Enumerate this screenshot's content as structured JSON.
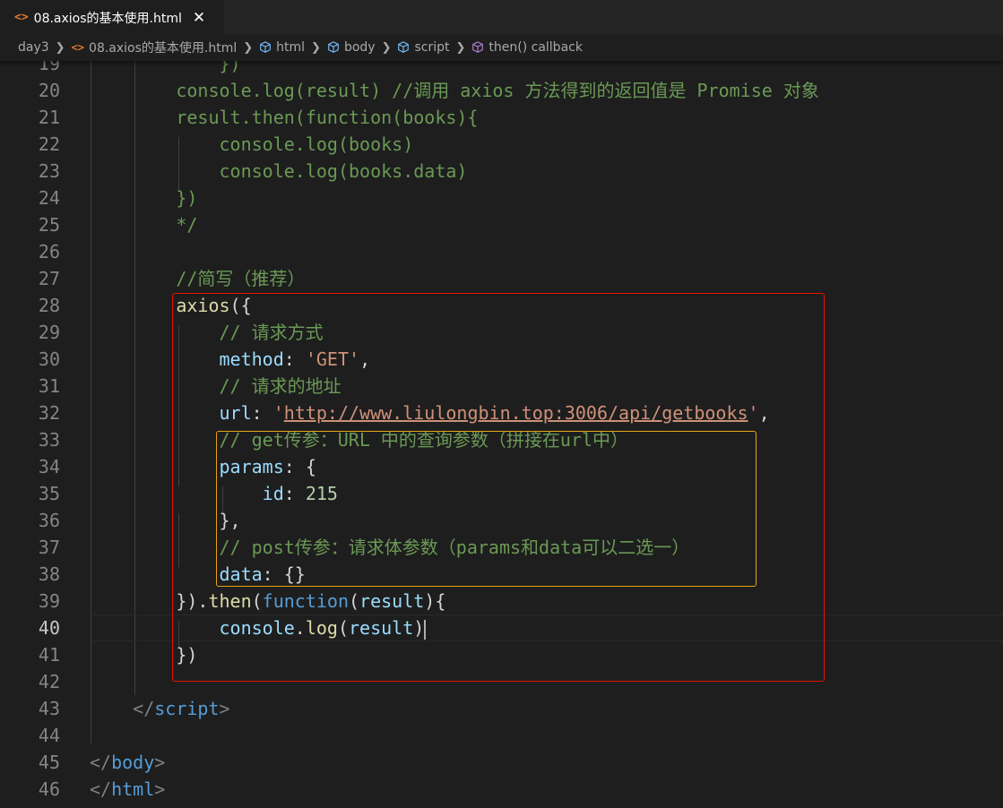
{
  "tab": {
    "title": "08.axios的基本使用.html",
    "close": "✕"
  },
  "breadcrumb": {
    "items": [
      {
        "label": "day3"
      },
      {
        "label": "08.axios的基本使用.html"
      },
      {
        "label": "html"
      },
      {
        "label": "body"
      },
      {
        "label": "script"
      },
      {
        "label": "then() callback"
      }
    ]
  },
  "editor": {
    "active_line": "40",
    "lines": [
      {
        "n": "19",
        "t": [
          [
            "c-comment",
            "            })"
          ]
        ]
      },
      {
        "n": "20",
        "t": [
          [
            "c-comment",
            "        console.log(result) //调用 axios 方法得到的返回值是 Promise 对象"
          ]
        ]
      },
      {
        "n": "21",
        "t": [
          [
            "c-comment",
            "        result.then(function(books){"
          ]
        ]
      },
      {
        "n": "22",
        "t": [
          [
            "c-comment",
            "            console.log(books)"
          ]
        ]
      },
      {
        "n": "23",
        "t": [
          [
            "c-comment",
            "            console.log(books.data)"
          ]
        ]
      },
      {
        "n": "24",
        "t": [
          [
            "c-comment",
            "        })"
          ]
        ]
      },
      {
        "n": "25",
        "t": [
          [
            "c-comment",
            "        */"
          ]
        ]
      },
      {
        "n": "26",
        "t": []
      },
      {
        "n": "27",
        "t": [
          [
            "c-comment",
            "        //简写（推荐）"
          ]
        ]
      },
      {
        "n": "28",
        "t": [
          [
            "c-plain",
            "        "
          ],
          [
            "c-fn",
            "axios"
          ],
          [
            "c-plain",
            "({"
          ]
        ]
      },
      {
        "n": "29",
        "t": [
          [
            "c-plain",
            "            "
          ],
          [
            "c-comment",
            "// 请求方式"
          ]
        ]
      },
      {
        "n": "30",
        "t": [
          [
            "c-plain",
            "            "
          ],
          [
            "c-var",
            "method"
          ],
          [
            "c-plain",
            ": "
          ],
          [
            "c-str",
            "'GET'"
          ],
          [
            "c-plain",
            ","
          ]
        ]
      },
      {
        "n": "31",
        "t": [
          [
            "c-plain",
            "            "
          ],
          [
            "c-comment",
            "// 请求的地址"
          ]
        ]
      },
      {
        "n": "32",
        "t": [
          [
            "c-plain",
            "            "
          ],
          [
            "c-var",
            "url"
          ],
          [
            "c-plain",
            ": "
          ],
          [
            "c-str",
            "'"
          ],
          [
            "c-url",
            "http://www.liulongbin.top:3006/api/getbooks"
          ],
          [
            "c-str",
            "'"
          ],
          [
            "c-plain",
            ","
          ]
        ]
      },
      {
        "n": "33",
        "t": [
          [
            "c-plain",
            "            "
          ],
          [
            "c-comment",
            "// get传参：URL 中的查询参数（拼接在url中）"
          ]
        ]
      },
      {
        "n": "34",
        "t": [
          [
            "c-plain",
            "            "
          ],
          [
            "c-var",
            "params"
          ],
          [
            "c-plain",
            ": {"
          ]
        ]
      },
      {
        "n": "35",
        "t": [
          [
            "c-plain",
            "                "
          ],
          [
            "c-var",
            "id"
          ],
          [
            "c-plain",
            ": "
          ],
          [
            "c-num",
            "215"
          ]
        ]
      },
      {
        "n": "36",
        "t": [
          [
            "c-plain",
            "            },"
          ]
        ]
      },
      {
        "n": "37",
        "t": [
          [
            "c-plain",
            "            "
          ],
          [
            "c-comment",
            "// post传参：请求体参数（params和data可以二选一）"
          ]
        ]
      },
      {
        "n": "38",
        "t": [
          [
            "c-plain",
            "            "
          ],
          [
            "c-var",
            "data"
          ],
          [
            "c-plain",
            ": {}"
          ]
        ]
      },
      {
        "n": "39",
        "t": [
          [
            "c-plain",
            "        })."
          ],
          [
            "c-fn",
            "then"
          ],
          [
            "c-plain",
            "("
          ],
          [
            "c-kw",
            "function"
          ],
          [
            "c-plain",
            "("
          ],
          [
            "c-var",
            "result"
          ],
          [
            "c-plain",
            "){"
          ]
        ]
      },
      {
        "n": "40",
        "t": [
          [
            "c-plain",
            "            "
          ],
          [
            "c-var",
            "console"
          ],
          [
            "c-plain",
            "."
          ],
          [
            "c-fn",
            "log"
          ],
          [
            "c-plain",
            "("
          ],
          [
            "c-var",
            "result"
          ],
          [
            "c-plain",
            ")"
          ]
        ]
      },
      {
        "n": "41",
        "t": [
          [
            "c-plain",
            "        })"
          ]
        ]
      },
      {
        "n": "42",
        "t": []
      },
      {
        "n": "43",
        "t": [
          [
            "c-plain",
            "    "
          ],
          [
            "c-punct",
            "</"
          ],
          [
            "c-tag",
            "script"
          ],
          [
            "c-punct",
            ">"
          ]
        ]
      },
      {
        "n": "44",
        "t": []
      },
      {
        "n": "45",
        "t": [
          [
            "c-punct",
            "</"
          ],
          [
            "c-tag",
            "body"
          ],
          [
            "c-punct",
            ">"
          ]
        ]
      },
      {
        "n": "46",
        "t": [
          [
            "c-punct",
            "</"
          ],
          [
            "c-tag",
            "html"
          ],
          [
            "c-punct",
            ">"
          ]
        ]
      }
    ]
  },
  "colors": {
    "background": "#1e1e1e",
    "red_highlight": "#e51400",
    "orange_highlight": "#e8a317",
    "comment": "#6a9955",
    "string": "#ce9178",
    "variable": "#9cdcfe",
    "function": "#dcdcaa",
    "keyword": "#569cd6"
  }
}
